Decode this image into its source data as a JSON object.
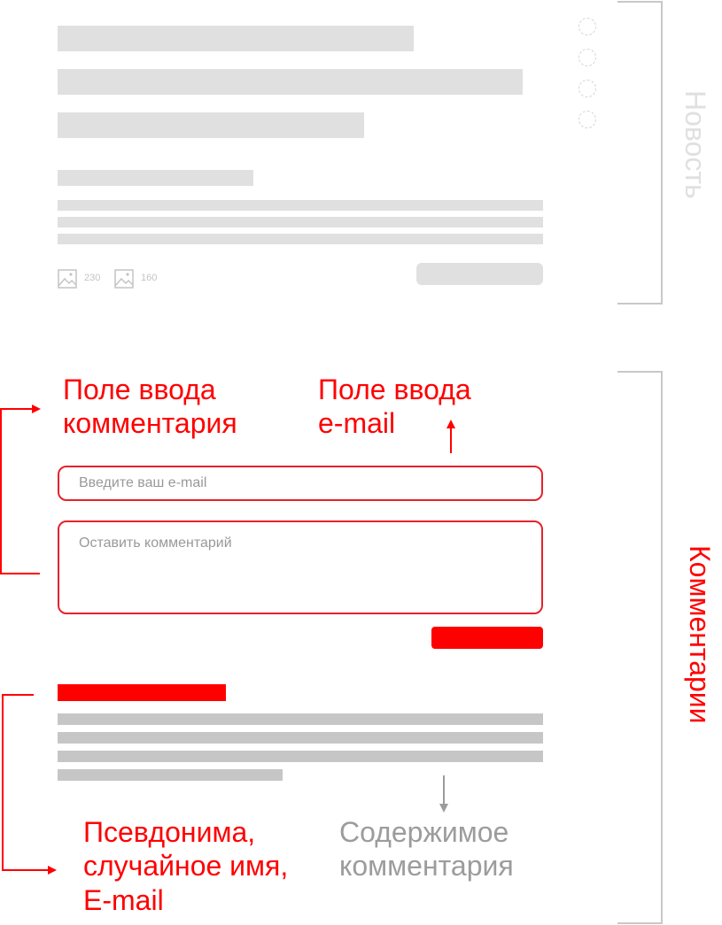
{
  "news": {
    "label": "Новость",
    "image_counts": [
      "230",
      "160"
    ]
  },
  "comments": {
    "label": "Комментарии",
    "email_placeholder": "Введите ваш e-mail",
    "comment_placeholder": "Оставить комментарий"
  },
  "annotations": {
    "comment_field": [
      "Поле ввода",
      "комментария"
    ],
    "email_field": [
      "Поле ввода",
      "e-mail"
    ],
    "author": [
      "Псевдонима,",
      "случайное имя,",
      "E-mail"
    ],
    "content": [
      "Содержимое",
      "комментария"
    ]
  },
  "colors": {
    "accent": "#ff0000",
    "field_border": "#e4232b",
    "placeholder_block": "#e0e0e0",
    "bracket": "#c8c8c8"
  },
  "icons": {
    "image": "image-icon"
  }
}
